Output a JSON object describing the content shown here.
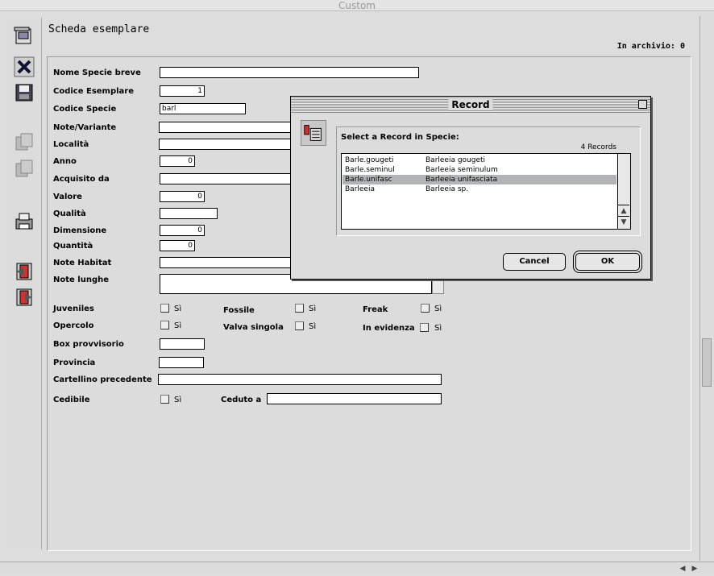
{
  "window": {
    "title": "Custom"
  },
  "header": {
    "title": "Scheda esemplare",
    "archive": "In archivio: 0"
  },
  "form": {
    "nome_specie_breve": {
      "label": "Nome Specie breve",
      "value": ""
    },
    "codice_esemplare": {
      "label": "Codice Esemplare",
      "value": "1"
    },
    "codice_specie": {
      "label": "Codice Specie",
      "value": "barl"
    },
    "note_variante": {
      "label": "Note/Variante",
      "value": ""
    },
    "localita": {
      "label": "Località",
      "value": ""
    },
    "anno": {
      "label": "Anno",
      "value": "0"
    },
    "acquisito_da": {
      "label": "Acquisito da",
      "value": ""
    },
    "valore": {
      "label": "Valore",
      "value": "0"
    },
    "qualita": {
      "label": "Qualità",
      "value": ""
    },
    "dimensione": {
      "label": "Dimensione",
      "value": "0"
    },
    "quantita": {
      "label": "Quantità",
      "value": "0"
    },
    "note_habitat": {
      "label": "Note Habitat",
      "value": ""
    },
    "note_lunghe": {
      "label": "Note lunghe",
      "value": ""
    },
    "juveniles": {
      "label": "Juveniles",
      "option": "Sì"
    },
    "fossile": {
      "label": "Fossile",
      "option": "Sì"
    },
    "freak": {
      "label": "Freak",
      "option": "Sì"
    },
    "opercolo": {
      "label": "Opercolo",
      "option": "Sì"
    },
    "valva_singola": {
      "label": "Valva singola",
      "option": "Sì"
    },
    "in_evidenza": {
      "label": "In evidenza",
      "option": "Sì"
    },
    "box_provvisorio": {
      "label": "Box provvisorio",
      "value": ""
    },
    "provincia": {
      "label": "Provincia",
      "value": ""
    },
    "cartellino_precedente": {
      "label": "Cartellino precedente",
      "value": ""
    },
    "cedibile": {
      "label": "Cedibile",
      "option": "Sì"
    },
    "ceduto_a": {
      "label": "Ceduto a",
      "value": ""
    }
  },
  "dialog": {
    "title": "Record",
    "prompt": "Select a Record in Specie:",
    "count": "4 Records",
    "rows": [
      {
        "code": "Barle.gougeti",
        "name": "Barleeia gougeti"
      },
      {
        "code": "Barle.seminul",
        "name": "Barleeia seminulum"
      },
      {
        "code": "Barle.unifasc",
        "name": "Barleeia unifasciata"
      },
      {
        "code": "Barleeia",
        "name": "Barleeia sp."
      }
    ],
    "cancel": "Cancel",
    "ok": "OK"
  }
}
